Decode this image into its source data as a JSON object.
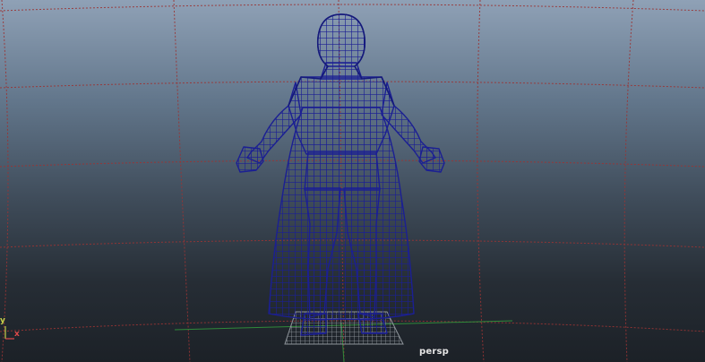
{
  "viewport": {
    "camera_label": "persp",
    "grid_color": "#9a3434",
    "wire_color": "#1b1f93",
    "axes": {
      "y_label": "y",
      "x_label": "x"
    }
  }
}
